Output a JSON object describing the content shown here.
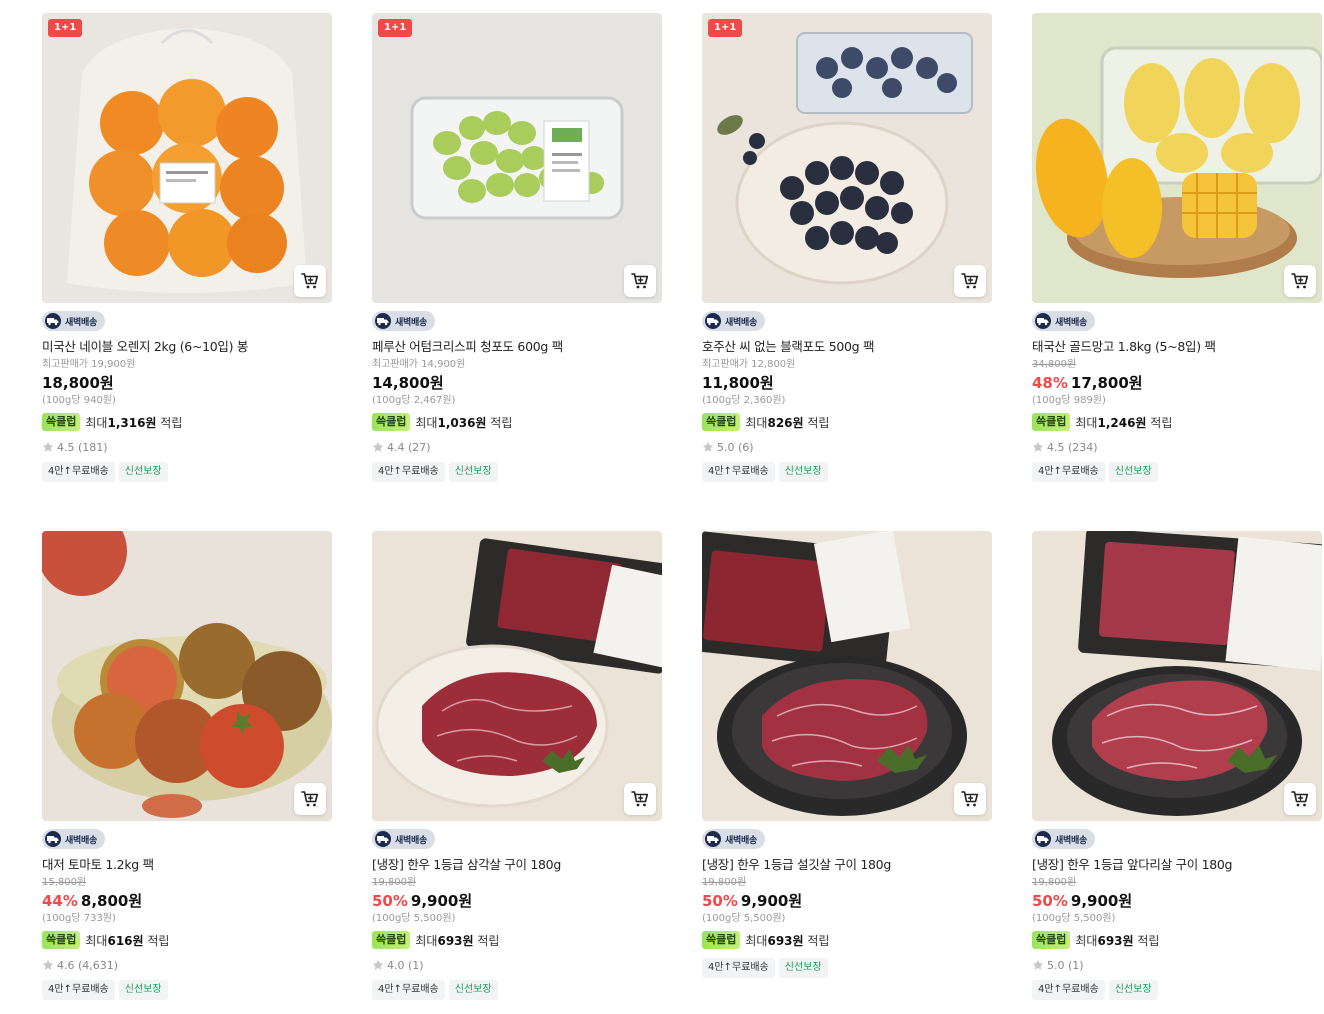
{
  "labels": {
    "dawn_delivery": "새벽배송",
    "reward_badge": "쓱클럽",
    "reward_prefix": "최대",
    "reward_suffix": " 적립",
    "free_shipping": "4만↑무료배송",
    "fresh_guarantee": "신선보장",
    "one_plus_one": "1+1"
  },
  "products": [
    {
      "name": "미국산 네이블 오렌지 2kg (6~10입) 봉",
      "orig": "최고판매가 19,900원",
      "strike": false,
      "discount": "",
      "price": "18,800원",
      "unit": "(100g당 940원)",
      "reward": "1,316원",
      "rating": "4.5 (181)",
      "badge": "1+1",
      "image": "oranges-in-bag"
    },
    {
      "name": "페루산 어텀크리스피 청포도 600g 팩",
      "orig": "최고판매가 14,900원",
      "strike": false,
      "discount": "",
      "price": "14,800원",
      "unit": "(100g당 2,467원)",
      "reward": "1,036원",
      "rating": "4.4 (27)",
      "badge": "1+1",
      "image": "green-grapes-pack"
    },
    {
      "name": "호주산 씨 없는 블랙포도 500g 팩",
      "orig": "최고판매가 12,800원",
      "strike": false,
      "discount": "",
      "price": "11,800원",
      "unit": "(100g당 2,360원)",
      "reward": "826원",
      "rating": "5.0 (6)",
      "badge": "1+1",
      "image": "black-grapes-plate"
    },
    {
      "name": "태국산 골드망고 1.8kg (5~8입) 팩",
      "orig": "34,800원",
      "strike": true,
      "discount": "48%",
      "price": "17,800원",
      "unit": "(100g당 989원)",
      "reward": "1,246원",
      "rating": "4.5 (234)",
      "badge": "",
      "image": "gold-mango-board"
    },
    {
      "name": "대저 토마토 1.2kg 팩",
      "orig": "15,800원",
      "strike": true,
      "discount": "44%",
      "price": "8,800원",
      "unit": "(100g당 733원)",
      "reward": "616원",
      "rating": "4.6 (4,631)",
      "badge": "",
      "image": "tomatoes-bowl"
    },
    {
      "name": "[냉장] 한우 1등급 삼각살 구이 180g",
      "orig": "19,800원",
      "strike": true,
      "discount": "50%",
      "price": "9,900원",
      "unit": "(100g당 5,500원)",
      "reward": "693원",
      "rating": "4.0 (1)",
      "badge": "",
      "image": "beef-light-plate"
    },
    {
      "name": "[냉장] 한우 1등급 설깃살 구이 180g",
      "orig": "19,800원",
      "strike": true,
      "discount": "50%",
      "price": "9,900원",
      "unit": "(100g당 5,500원)",
      "reward": "693원",
      "rating": "",
      "badge": "",
      "image": "beef-dark-plate"
    },
    {
      "name": "[냉장] 한우 1등급 앞다리살 구이 180g",
      "orig": "19,800원",
      "strike": true,
      "discount": "50%",
      "price": "9,900원",
      "unit": "(100g당 5,500원)",
      "reward": "693원",
      "rating": "5.0 (1)",
      "badge": "",
      "image": "beef-dark-plate-2"
    }
  ]
}
